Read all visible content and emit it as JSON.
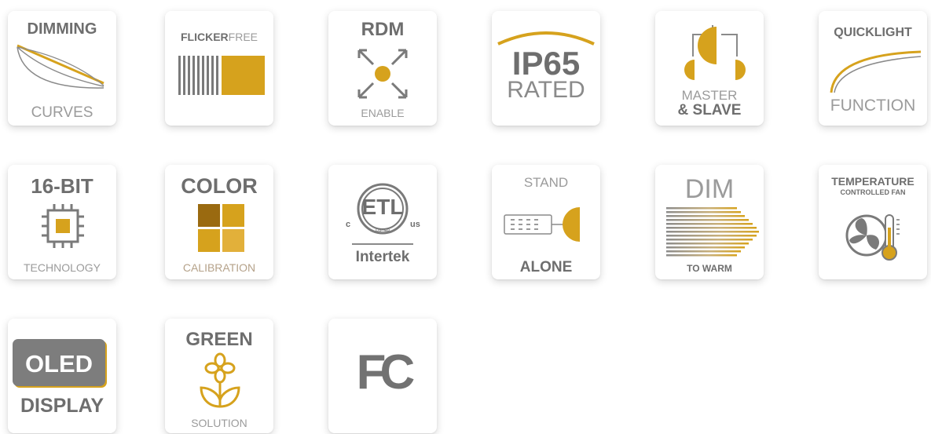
{
  "colors": {
    "gold": "#d6a21d",
    "gray": "#7a7a7a",
    "light_gray": "#a5a5a5",
    "tile_bg": "#ffffff"
  },
  "tiles": [
    {
      "icon": "dimming-curves-icon",
      "top": "DIMMING",
      "bottom": "CURVES"
    },
    {
      "icon": "flicker-free-icon",
      "top_bold": "FLICKER",
      "top_light": "FREE"
    },
    {
      "icon": "rdm-icon",
      "top": "RDM",
      "bottom": "ENABLE"
    },
    {
      "icon": "ip65-icon",
      "top": "IP65",
      "bottom": "RATED"
    },
    {
      "icon": "master-slave-icon",
      "line1": "MASTER",
      "line2": "& SLAVE"
    },
    {
      "icon": "quicklight-icon",
      "top": "QUICKLIGHT",
      "bottom": "FUNCTION"
    },
    {
      "icon": "chip-icon",
      "top": "16-BIT",
      "bottom": "TECHNOLOGY"
    },
    {
      "icon": "color-calibration-icon",
      "top": "COLOR",
      "bottom": "CALIBRATION"
    },
    {
      "icon": "etl-icon",
      "c": "c",
      "etl": "ETL",
      "listed": "LISTED",
      "us": "us",
      "bottom": "Intertek"
    },
    {
      "icon": "stand-alone-icon",
      "top": "STAND",
      "bottom": "ALONE"
    },
    {
      "icon": "dim-to-warm-icon",
      "top": "DIM",
      "bottom": "TO WARM"
    },
    {
      "icon": "fan-thermometer-icon",
      "top": "TEMPERATURE",
      "sub": "CONTROLLED FAN"
    },
    {
      "icon": "oled-icon",
      "top": "OLED",
      "bottom": "DISPLAY"
    },
    {
      "icon": "leaf-icon",
      "top": "GREEN",
      "bottom": "SOLUTION"
    },
    {
      "icon": "fcc-icon",
      "text": "FC"
    }
  ]
}
